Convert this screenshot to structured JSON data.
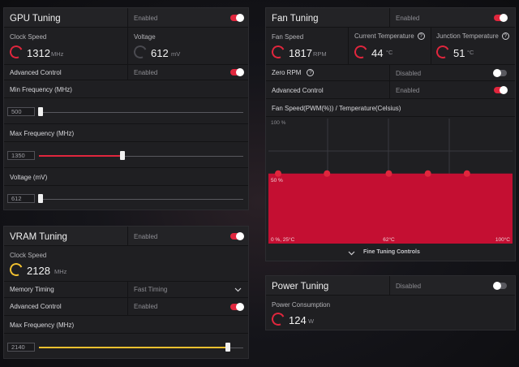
{
  "colors": {
    "accent": "#e0263d",
    "vram_accent": "#f0c030",
    "panel": "#1f1f22"
  },
  "gpu": {
    "title": "GPU Tuning",
    "state": "Enabled",
    "clock": {
      "label": "Clock Speed",
      "value": "1312",
      "unit": "MHz"
    },
    "voltage": {
      "label": "Voltage",
      "value": "612",
      "unit": "mV"
    },
    "advanced": {
      "label": "Advanced Control",
      "state": "Enabled"
    },
    "min_freq": {
      "label": "Min Frequency (MHz)",
      "value": "500",
      "fraction": 0.0
    },
    "max_freq": {
      "label": "Max Frequency (MHz)",
      "value": "1350",
      "fraction": 0.408
    },
    "volt_slider": {
      "label": "Voltage (mV)",
      "value": "612",
      "fraction": 0.0
    }
  },
  "vram": {
    "title": "VRAM Tuning",
    "state": "Enabled",
    "clock": {
      "label": "Clock Speed",
      "value": "2128",
      "unit": "MHz"
    },
    "timing": {
      "label": "Memory Timing",
      "value": "Fast Timing"
    },
    "advanced": {
      "label": "Advanced Control",
      "state": "Enabled"
    },
    "max_freq": {
      "label": "Max Frequency (MHz)",
      "value": "2140",
      "fraction": 0.925
    }
  },
  "fan": {
    "title": "Fan Tuning",
    "state": "Enabled",
    "speed": {
      "label": "Fan Speed",
      "value": "1817",
      "unit": "RPM"
    },
    "current_temp": {
      "label": "Current Temperature",
      "value": "44",
      "unit": "°C"
    },
    "junction_temp": {
      "label": "Junction Temperature",
      "value": "51",
      "unit": "°C"
    },
    "zero_rpm": {
      "label": "Zero RPM",
      "state": "Disabled"
    },
    "advanced": {
      "label": "Advanced Control",
      "state": "Enabled"
    },
    "curve_title": "Fan Speed(PWM(%)) / Temperature(Celsius)",
    "y_top": "100 %",
    "y_mid": "50 %",
    "x_labels": [
      "0 %, 25°C",
      "62°C",
      "100°C"
    ],
    "fine_tuning": "Fine Tuning Controls"
  },
  "power": {
    "title": "Power Tuning",
    "state": "Disabled",
    "consumption": {
      "label": "Power Consumption",
      "value": "124",
      "unit": "W"
    }
  },
  "chart_data": {
    "type": "area",
    "title": "Fan Speed(PWM(%)) / Temperature(Celsius)",
    "xlabel": "",
    "ylabel": "",
    "x_ticks": [
      "25°C",
      "62°C",
      "100°C"
    ],
    "y_ticks": [
      "0 %",
      "50 %",
      "100 %"
    ],
    "xlim": [
      25,
      100
    ],
    "ylim": [
      0,
      100
    ],
    "series": [
      {
        "x": [
          25,
          43,
          62,
          74,
          86,
          100
        ],
        "y": [
          56,
          56,
          56,
          56,
          56,
          56
        ]
      }
    ],
    "points_shown": [
      25,
      43,
      62,
      74,
      86
    ],
    "grid": true
  }
}
